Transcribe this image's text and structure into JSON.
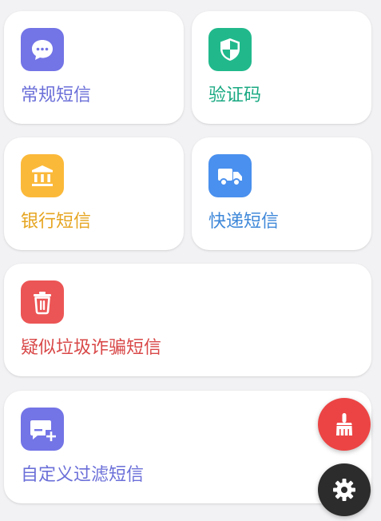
{
  "cards": {
    "general": {
      "label": "常规短信",
      "icon": "chat-bubble-icon",
      "color": "#6b6fd8",
      "icon_bg": "#7374e6"
    },
    "verify": {
      "label": "验证码",
      "icon": "shield-icon",
      "color": "#1aa982",
      "icon_bg": "#21b98c"
    },
    "bank": {
      "label": "银行短信",
      "icon": "bank-icon",
      "color": "#e6a521",
      "icon_bg": "#fbb93a"
    },
    "express": {
      "label": "快递短信",
      "icon": "truck-icon",
      "color": "#3f88d9",
      "icon_bg": "#4a90ee"
    },
    "spam": {
      "label": "疑似垃圾诈骗短信",
      "icon": "trash-icon",
      "color": "#d94848",
      "icon_bg": "#ec5555"
    },
    "custom": {
      "label": "自定义过滤短信",
      "icon": "message-add-icon",
      "color": "#6b6fd8",
      "icon_bg": "#7374e6"
    }
  },
  "fabs": {
    "clean": {
      "icon": "broom-icon",
      "color": "#ec4444"
    },
    "settings": {
      "icon": "gear-icon",
      "color": "#2c2c2c"
    }
  }
}
